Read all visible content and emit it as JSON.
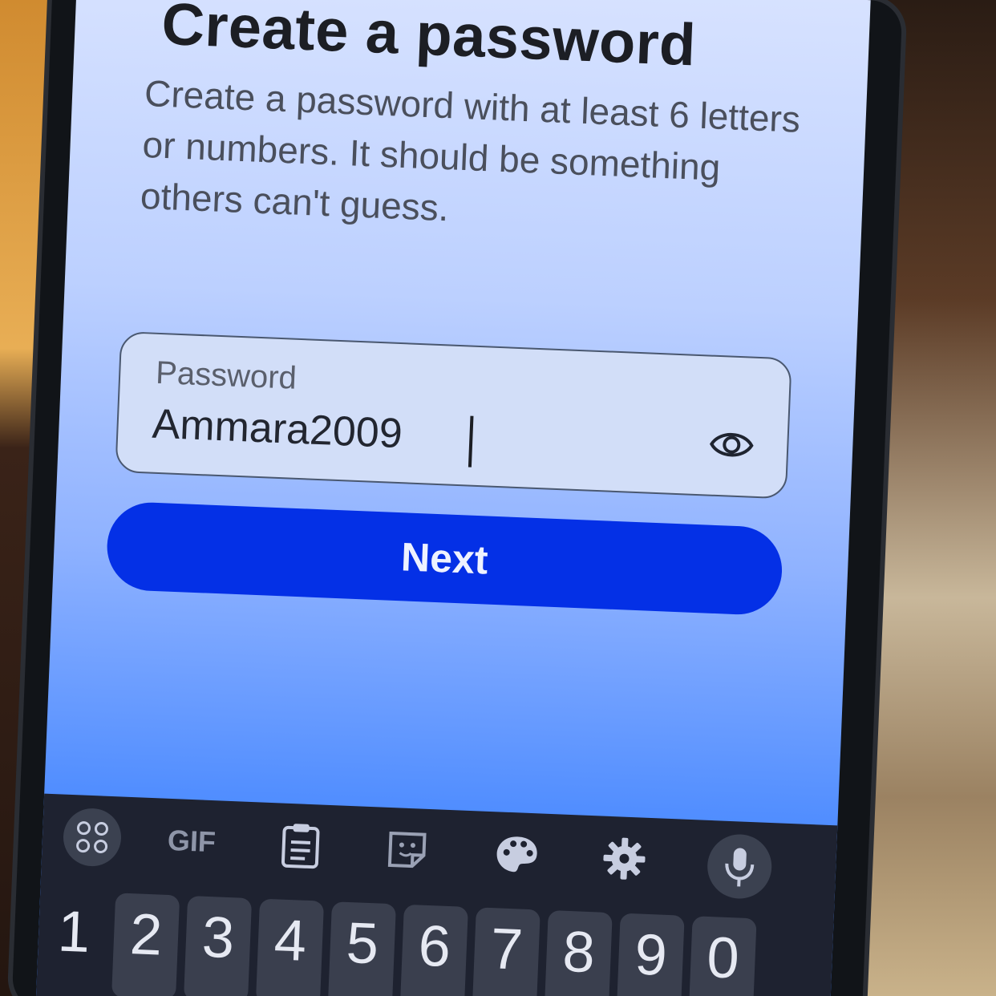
{
  "page": {
    "title": "Create a password",
    "subtitle": "Create a password with at least 6 letters or numbers. It should be something others can't guess."
  },
  "password_field": {
    "label": "Password",
    "value": "Ammara2009",
    "reveal_icon": "eye-icon"
  },
  "next_button": {
    "label": "Next"
  },
  "keyboard": {
    "toolbar": {
      "apps_icon": "grid-apps-icon",
      "gif_label": "GIF",
      "clipboard_icon": "clipboard-icon",
      "sticker_icon": "sticker-icon",
      "theme_icon": "palette-icon",
      "settings_icon": "gear-icon",
      "voice_icon": "microphone-icon"
    },
    "number_row": [
      "1",
      "2",
      "3",
      "4",
      "5",
      "6",
      "7",
      "8",
      "9",
      "0"
    ]
  },
  "colors": {
    "primary_button": "#0430e6",
    "screen_background": "#bcd0ff",
    "keyboard_background": "#1e2230"
  }
}
